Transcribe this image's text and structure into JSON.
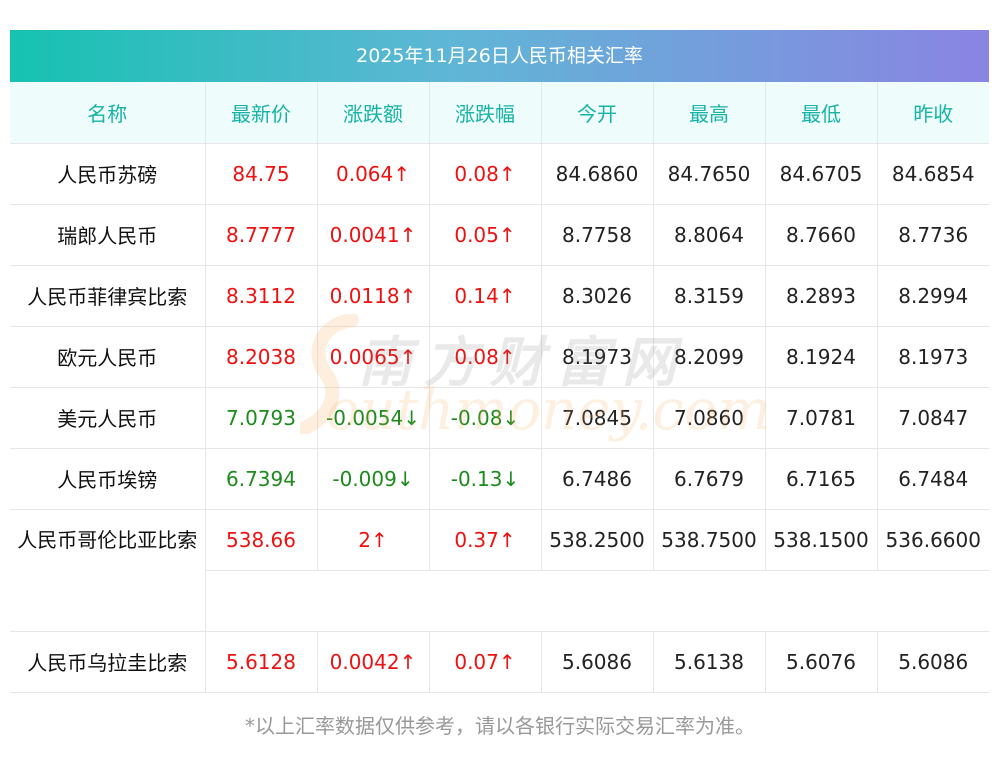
{
  "title": "2025年11月26日人民币相关汇率",
  "headers": [
    "名称",
    "最新价",
    "涨跌额",
    "涨跌幅",
    "今开",
    "最高",
    "最低",
    "昨收"
  ],
  "rows": [
    {
      "name": "人民币苏磅",
      "latest": "84.75",
      "change": "0.064↑",
      "pct": "0.08↑",
      "open": "84.6860",
      "high": "84.7650",
      "low": "84.6705",
      "prev": "84.6854",
      "trend": "up"
    },
    {
      "name": "瑞郎人民币",
      "latest": "8.7777",
      "change": "0.0041↑",
      "pct": "0.05↑",
      "open": "8.7758",
      "high": "8.8064",
      "low": "8.7660",
      "prev": "8.7736",
      "trend": "up"
    },
    {
      "name": "人民币菲律宾比索",
      "latest": "8.3112",
      "change": "0.0118↑",
      "pct": "0.14↑",
      "open": "8.3026",
      "high": "8.3159",
      "low": "8.2893",
      "prev": "8.2994",
      "trend": "up"
    },
    {
      "name": "欧元人民币",
      "latest": "8.2038",
      "change": "0.0065↑",
      "pct": "0.08↑",
      "open": "8.1973",
      "high": "8.2099",
      "low": "8.1924",
      "prev": "8.1973",
      "trend": "up"
    },
    {
      "name": "美元人民币",
      "latest": "7.0793",
      "change": "-0.0054↓",
      "pct": "-0.08↓",
      "open": "7.0845",
      "high": "7.0860",
      "low": "7.0781",
      "prev": "7.0847",
      "trend": "down"
    },
    {
      "name": "人民币埃镑",
      "latest": "6.7394",
      "change": "-0.009↓",
      "pct": "-0.13↓",
      "open": "6.7486",
      "high": "6.7679",
      "low": "6.7165",
      "prev": "6.7484",
      "trend": "down"
    },
    {
      "name": "人民币哥伦比亚比索",
      "latest": "538.66",
      "change": "2↑",
      "pct": "0.37↑",
      "open": "538.2500",
      "high": "538.7500",
      "low": "538.1500",
      "prev": "536.6600",
      "trend": "up"
    },
    {
      "name": "人民币乌拉圭比索",
      "latest": "5.6128",
      "change": "0.0042↑",
      "pct": "0.07↑",
      "open": "5.6086",
      "high": "5.6138",
      "low": "5.6076",
      "prev": "5.6086",
      "trend": "up"
    }
  ],
  "watermark": {
    "cn": "南方财富网",
    "en": "outhmoney.com"
  },
  "footer": "*以上汇率数据仅供参考，请以各银行实际交易汇率为准。",
  "colors": {
    "up": "#ee1111",
    "down": "#1d8a1d",
    "header": "#17b3a4",
    "gradient_start": "#16c2b1",
    "gradient_end": "#8a84e2"
  }
}
